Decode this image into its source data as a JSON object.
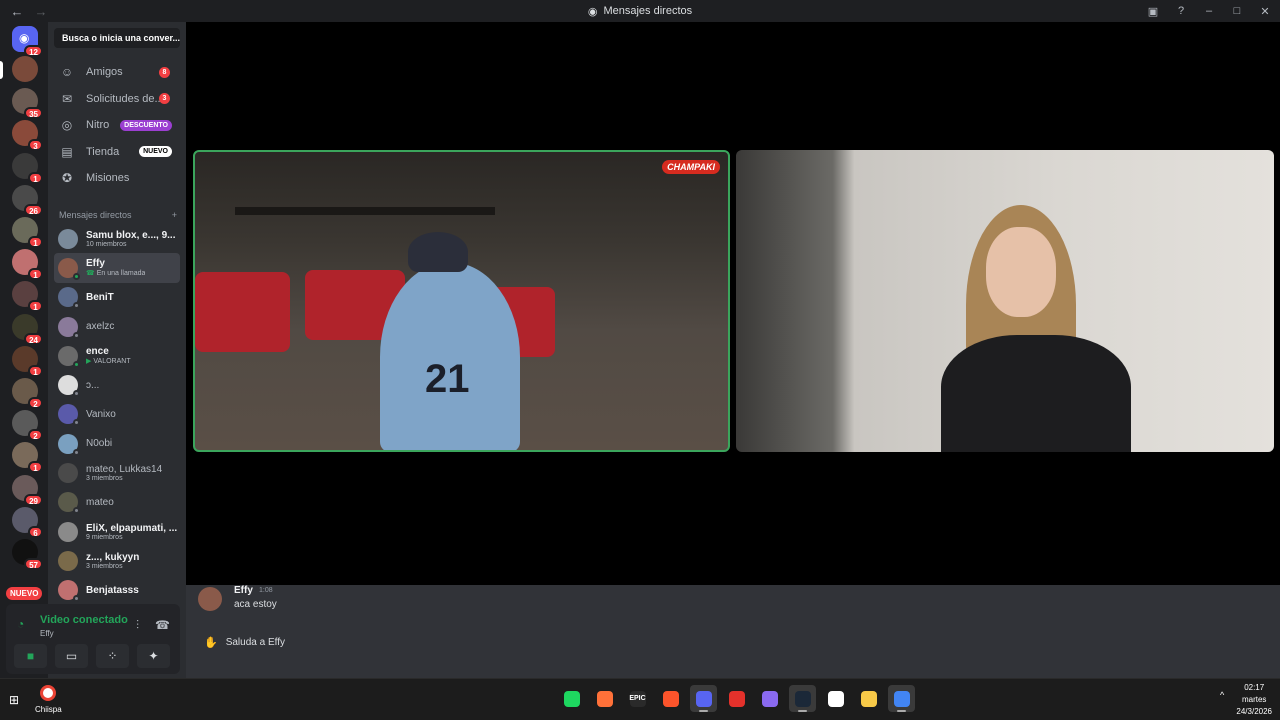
{
  "window": {
    "title": "Mensajes directos"
  },
  "rail": {
    "home_badge": "12",
    "servers": [
      {
        "badge": "",
        "color": "#7a4a3a"
      },
      {
        "badge": "35",
        "color": "#6a5a52"
      },
      {
        "badge": "3",
        "color": "#8a4a3a"
      },
      {
        "badge": "1",
        "color": "#3a3a3a"
      },
      {
        "badge": "26",
        "color": "#4a4a4a"
      },
      {
        "badge": "1",
        "color": "#6a6a5a"
      },
      {
        "badge": "1",
        "color": "#c07070"
      },
      {
        "badge": "1",
        "color": "#5a4040"
      },
      {
        "badge": "24",
        "color": "#3a3a2a"
      },
      {
        "badge": "1",
        "color": "#5a3a2a"
      },
      {
        "badge": "2",
        "color": "#6a5a4a"
      },
      {
        "badge": "2",
        "color": "#5a5a5a"
      },
      {
        "badge": "1",
        "color": "#7a6a5a"
      },
      {
        "badge": "29",
        "color": "#6a5a5a"
      },
      {
        "badge": "6",
        "color": "#5a5a6a"
      },
      {
        "badge": "57",
        "color": "#111111"
      }
    ],
    "new_label": "NUEVO"
  },
  "sidebar": {
    "search_placeholder": "Busca o inicia una conver...",
    "nav": [
      {
        "label": "Amigos",
        "icon": "friends-icon",
        "count": "8"
      },
      {
        "label": "Solicitudes de...",
        "icon": "mail-icon",
        "count": "3"
      },
      {
        "label": "Nitro",
        "icon": "nitro-icon",
        "tag": "DESCUENTO"
      },
      {
        "label": "Tienda",
        "icon": "shop-icon",
        "tag": "NUEVO"
      },
      {
        "label": "Misiones",
        "icon": "quests-icon"
      }
    ],
    "dm_header": "Mensajes directos",
    "dms": [
      {
        "name": "Samu blox, e..., 9...",
        "sub": "10 miembros",
        "bold": true,
        "color": "#7a8a9a"
      },
      {
        "name": "Effy",
        "sub": "En una llamada",
        "bold": true,
        "selected": true,
        "call": true,
        "color": "#8a5a4a"
      },
      {
        "name": "BeniT",
        "bold": true,
        "color": "#5a6a8a"
      },
      {
        "name": "axelzc",
        "color": "#8a7a9a"
      },
      {
        "name": "ence",
        "sub": "VALORANT",
        "bold": true,
        "game": true,
        "color": "#6a6a6a"
      },
      {
        "name": "ɔ...",
        "color": "#ddd"
      },
      {
        "name": "Vanixo",
        "color": "#5a5aaa"
      },
      {
        "name": "N0obi",
        "color": "#7aa0c0"
      },
      {
        "name": "mateo, Lukkas14",
        "sub": "3 miembros",
        "color": "#4a4a4a"
      },
      {
        "name": "mateo",
        "color": "#5a5a4a"
      },
      {
        "name": "EliX, elpapumati, ...",
        "sub": "9 miembros",
        "bold": true,
        "color": "#8a8a8a"
      },
      {
        "name": "z..., kukyyn",
        "sub": "3 miembros",
        "bold": true,
        "color": "#7a6a4a"
      },
      {
        "name": "Benjatasss",
        "bold": true,
        "color": "#c07070"
      }
    ]
  },
  "voice": {
    "status": "Video conectado",
    "channel": "Effy"
  },
  "call": {
    "tile1_logo": "CHAMPAKI"
  },
  "chat": {
    "author": "Effy",
    "time": "1:08",
    "text": "aca estoy",
    "wave_label": "Saluda a Effy"
  },
  "taskbar": {
    "pinned_label": "Chiispa",
    "apps": [
      {
        "name": "spotify-icon",
        "color": "#1ed760",
        "glyph": ""
      },
      {
        "name": "firefox-icon",
        "color": "#ff7139",
        "glyph": ""
      },
      {
        "name": "epic-icon",
        "color": "#2a2a2a",
        "glyph": "EPIC"
      },
      {
        "name": "brave-icon",
        "color": "#fb542b",
        "glyph": ""
      },
      {
        "name": "discord-icon",
        "color": "#5865f2",
        "glyph": "",
        "active": true
      },
      {
        "name": "rockstar-icon",
        "color": "#e4312b",
        "glyph": ""
      },
      {
        "name": "copilot-icon",
        "color": "#8a6af0",
        "glyph": ""
      },
      {
        "name": "steam-icon",
        "color": "#1b2838",
        "glyph": "",
        "active": true
      },
      {
        "name": "capcut-icon",
        "color": "#ffffff",
        "glyph": ""
      },
      {
        "name": "explorer-icon",
        "color": "#f7c948",
        "glyph": ""
      },
      {
        "name": "chrome-icon",
        "color": "#4285f4",
        "glyph": "",
        "active": true
      }
    ],
    "time": "02:17",
    "day": "martes",
    "date": "24/3/2026"
  }
}
